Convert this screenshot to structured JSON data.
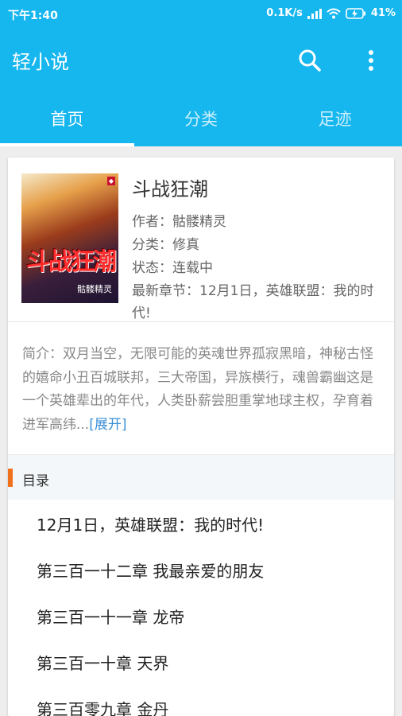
{
  "status_bar": {
    "time": "下午1:40",
    "speed": "0.1K/s",
    "network": "4G",
    "battery": "41%"
  },
  "app_bar": {
    "title": "轻小说",
    "search_icon": "search-icon",
    "more_icon": "more-vert-icon"
  },
  "tabs": [
    {
      "label": "首页",
      "active": true
    },
    {
      "label": "分类",
      "active": false
    },
    {
      "label": "足迹",
      "active": false
    }
  ],
  "book": {
    "cover_title": "斗战狂潮",
    "cover_author": "骷髅精灵",
    "title": "斗战狂潮",
    "author": "作者：骷髅精灵",
    "category": "分类：修真",
    "status": "状态：连载中",
    "latest": "最新章节：12月1日，英雄联盟：我的时代!",
    "intro": "简介：双月当空，无限可能的英魂世界孤寂黑暗，神秘古怪的嬉命小丑百城联邦，三大帝国，异族横行，魂兽霸幽这是一个英雄辈出的年代，人类卧薪尝胆重掌地球主权，孕育着进军高纬...",
    "expand": "[展开]"
  },
  "toc": {
    "label": "目录",
    "chapters": [
      "12月1日，英雄联盟：我的时代!",
      "第三百一十二章 我最亲爱的朋友",
      "第三百一十一章 龙帝",
      "第三百一十章 天界",
      "第三百零九章 金丹"
    ]
  },
  "colors": {
    "primary": "#16b6ef",
    "accent": "#f0711b",
    "link": "#3b8fd6"
  }
}
